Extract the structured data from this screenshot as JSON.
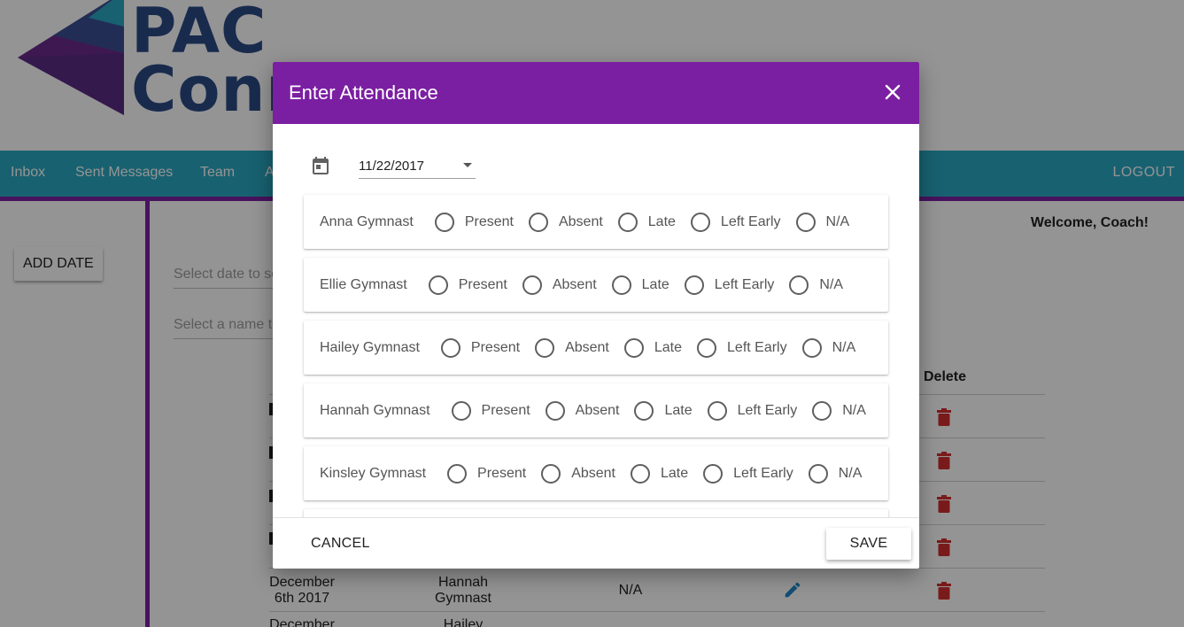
{
  "logo": {
    "line1": "PAC",
    "line2": "Conn"
  },
  "nav": {
    "items": [
      "Inbox",
      "Sent Messages",
      "Team",
      "A"
    ],
    "logout": "LOGOUT"
  },
  "sidebar": {
    "add_date": "ADD DATE"
  },
  "filters": {
    "date_placeholder": "Select date to se",
    "name_placeholder": "Select a name to"
  },
  "welcome": "Welcome, Coach!",
  "table": {
    "delete_header": "Delete",
    "visible_row": {
      "date": "December 6th 2017",
      "name": "Hannah Gymnast",
      "status": "N/A"
    },
    "partial_row": {
      "date": "December",
      "name": "Hailey"
    }
  },
  "colors": {
    "primary": "#7b1fa2",
    "nav": "#2aa8c2",
    "delete": "#d32f2f",
    "edit": "#1e88c8"
  },
  "modal": {
    "title": "Enter Attendance",
    "date_value": "11/22/2017",
    "options": [
      "Present",
      "Absent",
      "Late",
      "Left Early",
      "N/A"
    ],
    "gymnasts": [
      "Anna Gymnast",
      "Ellie Gymnast",
      "Hailey Gymnast",
      "Hannah Gymnast",
      "Kinsley Gymnast"
    ],
    "cancel": "CANCEL",
    "save": "SAVE"
  }
}
